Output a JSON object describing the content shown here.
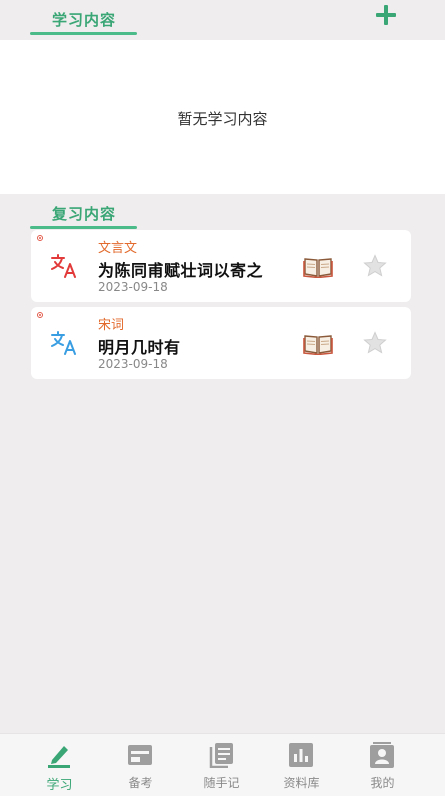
{
  "learn_section": {
    "title": "学习内容",
    "empty_text": "暂无学习内容"
  },
  "review_section": {
    "title": "复习内容",
    "items": [
      {
        "category": "文言文",
        "title": "为陈同甫赋壮词以寄之",
        "date": "2023-09-18",
        "icon_color": "#e23a3a"
      },
      {
        "category": "宋词",
        "title": "明月几时有",
        "date": "2023-09-18",
        "icon_color": "#3a9ee2"
      }
    ]
  },
  "tabbar": {
    "tabs": [
      {
        "label": "学习",
        "icon": "pencil-icon",
        "active": true
      },
      {
        "label": "备考",
        "icon": "card-icon",
        "active": false
      },
      {
        "label": "随手记",
        "icon": "notes-icon",
        "active": false
      },
      {
        "label": "资料库",
        "icon": "chart-icon",
        "active": false
      },
      {
        "label": "我的",
        "icon": "contact-icon",
        "active": false
      }
    ]
  },
  "colors": {
    "accent": "#3aa676",
    "category": "#e26a2c",
    "background": "#efeded"
  }
}
